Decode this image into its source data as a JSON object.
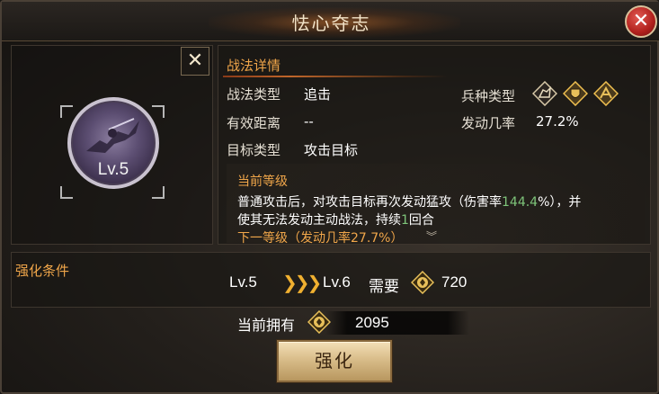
{
  "window": {
    "title": "怯心夺志"
  },
  "skill": {
    "level_label": "Lv.5"
  },
  "details": {
    "header": "战法详情",
    "type_label": "战法类型",
    "type_value": "追击",
    "range_label": "有效距离",
    "range_value": "--",
    "target_label": "目标类型",
    "target_value": "攻击目标",
    "troop_label": "兵种类型",
    "trigger_label": "发动几率",
    "trigger_value": "27.2%",
    "troop_icons": [
      "cavalry-icon",
      "shield-icon",
      "archer-icon"
    ]
  },
  "description": {
    "title": "当前等级",
    "line1_a": "普通攻击后，对攻击目标再次发动猛攻（伤害率",
    "line1_rate": "144.4",
    "line1_b": "%），并",
    "line2_a": "使其无法发动主动战法，持续",
    "line2_num": "1",
    "line2_b": "回合",
    "next_level": "下一等级（发动几率27.7%）"
  },
  "enhance": {
    "title": "强化条件",
    "from_level": "Lv.5",
    "to_level": "Lv.6",
    "need_label": "需要",
    "cost": "720",
    "own_label": "当前拥有",
    "own_value": "2095",
    "button_label": "强化"
  },
  "colors": {
    "accent": "#f0a64a",
    "highlight_green": "#7ec47a",
    "close_red": "#b0201c"
  }
}
